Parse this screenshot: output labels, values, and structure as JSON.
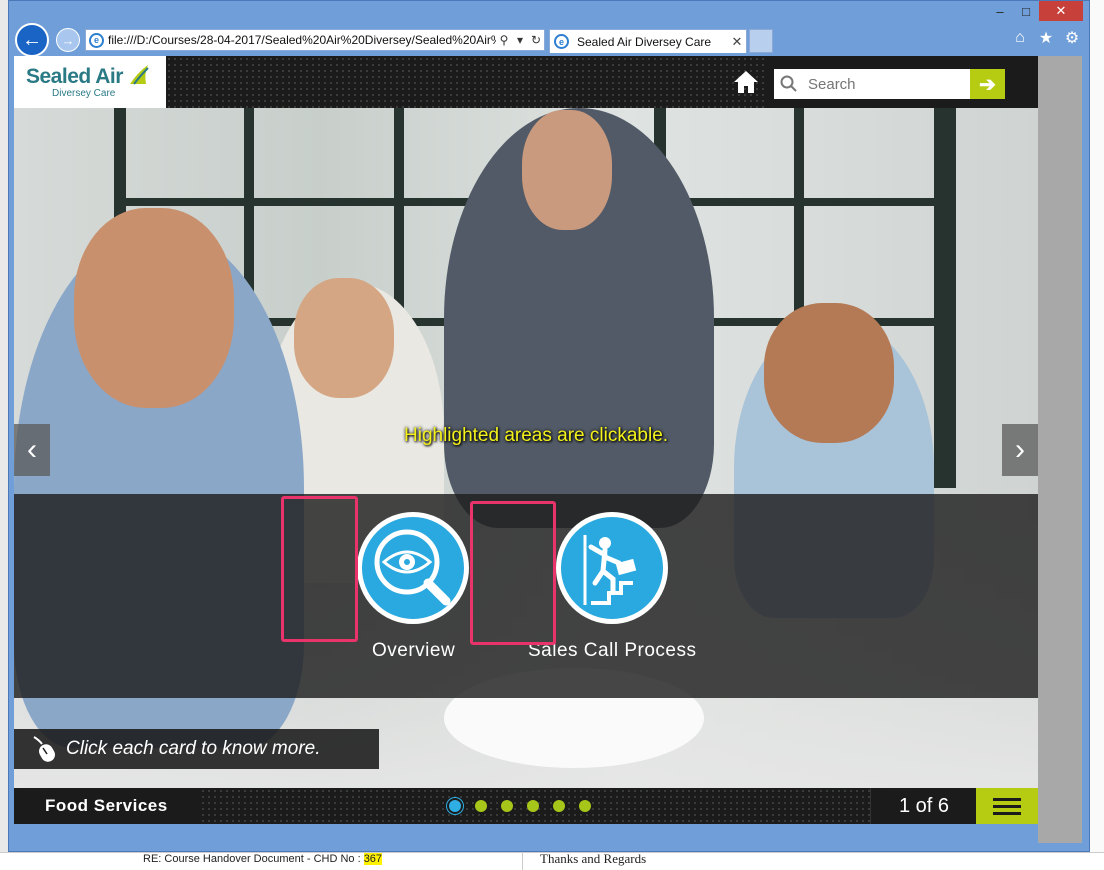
{
  "browser": {
    "address": "file:///D:/Courses/28-04-2017/Sealed%20Air%20Diversey/Sealed%20Air%",
    "tab_title": "Sealed Air Diversey Care",
    "window_buttons": {
      "minimize": "–",
      "maximize": "□",
      "close": "✕"
    }
  },
  "background_app": {
    "mail_subject_prefix": "RE: Course Handover Document - CHD No : ",
    "mail_subject_number": "367",
    "mail_body_fragment": "Thanks and Regards"
  },
  "course": {
    "logo": {
      "main": "Sealed Air",
      "sub": "Diversey Care"
    },
    "search": {
      "placeholder": "Search"
    },
    "hint": "Highlighted areas are clickable.",
    "cards": [
      {
        "label": "Overview",
        "icon": "eye-magnifier-icon"
      },
      {
        "label": "Sales Call Process",
        "icon": "person-climbing-stairs-icon"
      }
    ],
    "instruction": "Click each card to know more.",
    "footer": {
      "section_title": "Food Services",
      "page_indicator": "1 of 6",
      "total_pages": 6,
      "current_page": 1
    }
  },
  "colors": {
    "accent_green": "#b6cc12",
    "card_blue": "#29a9df",
    "hotspot_pink": "#e8336b",
    "hint_yellow": "#f3f11a",
    "browser_blue": "#6f9ed8"
  }
}
